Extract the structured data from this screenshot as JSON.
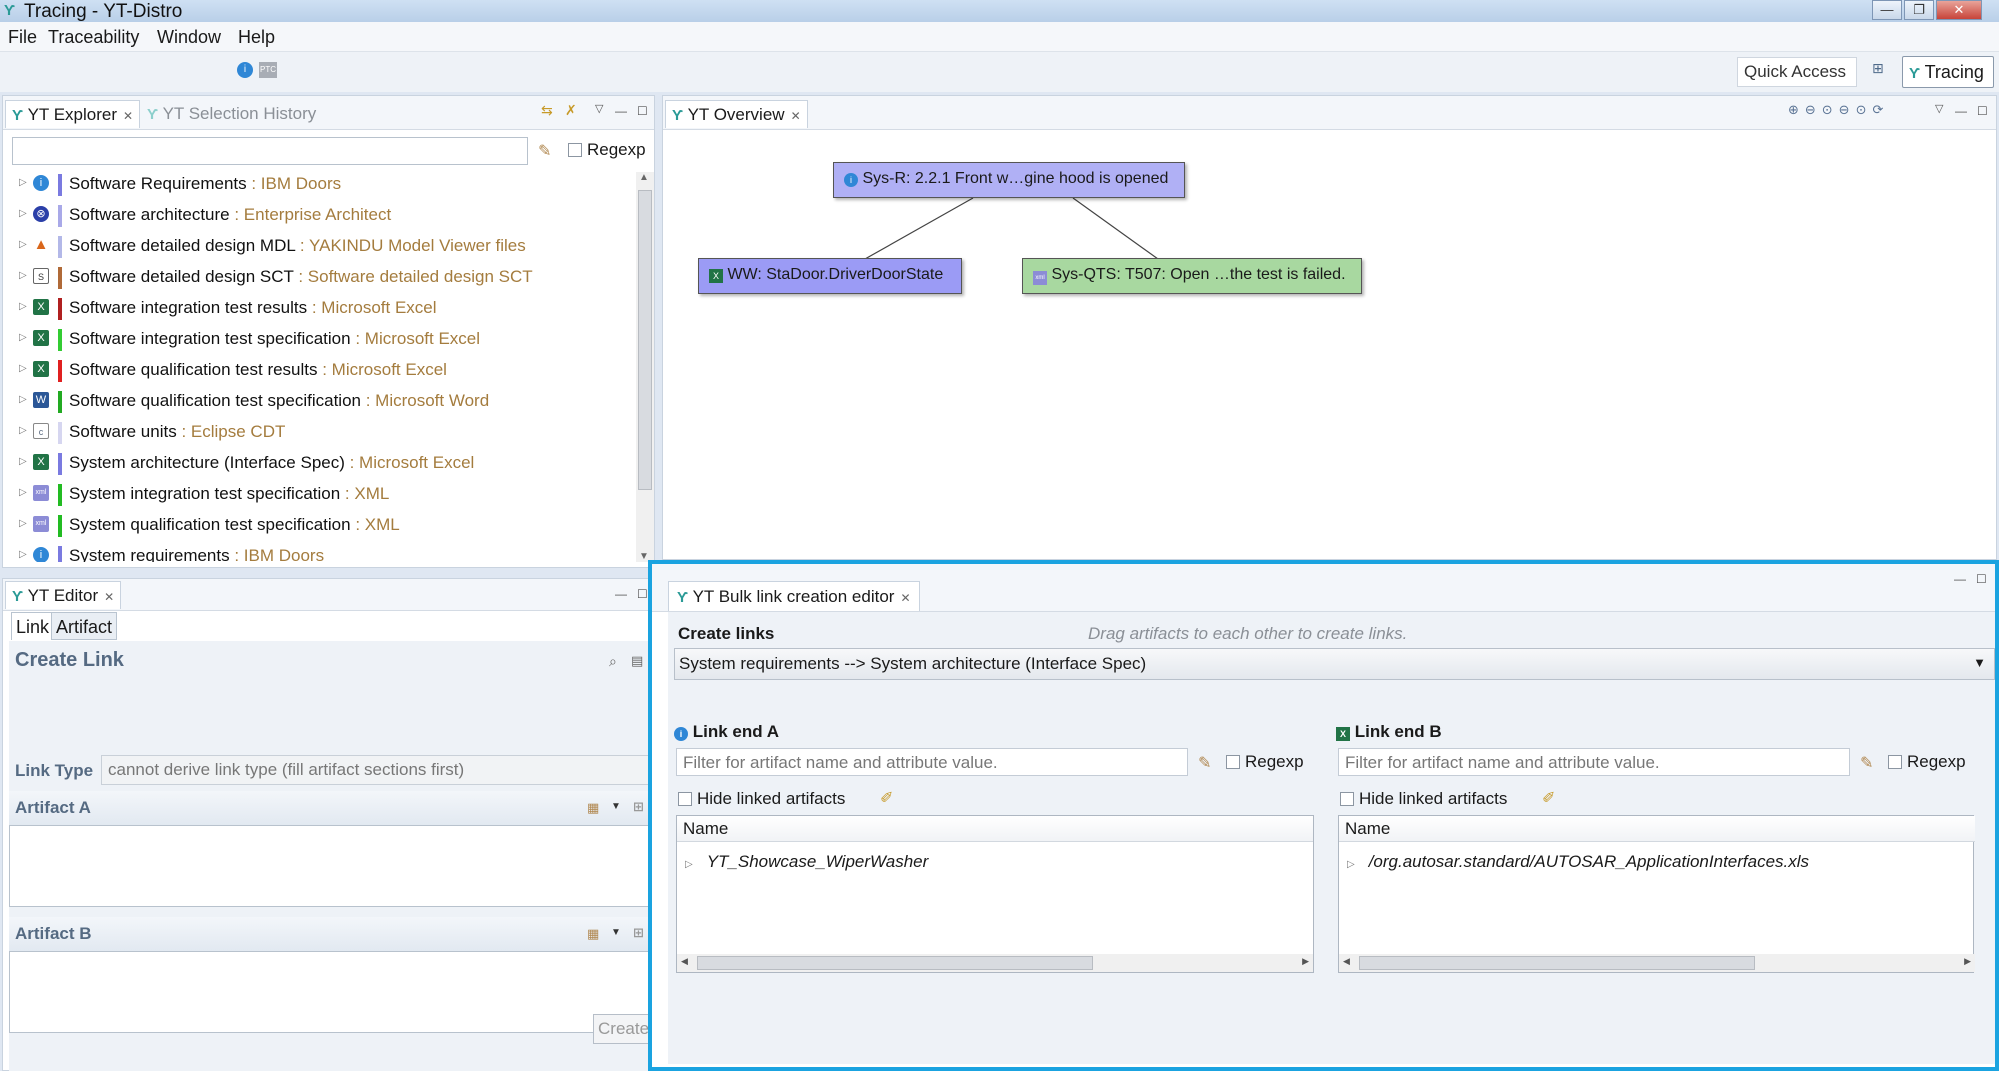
{
  "window": {
    "title": "Tracing - YT-Distro",
    "controls": {
      "minimize": "—",
      "maximize": "❐",
      "close": "✕"
    }
  },
  "menu": [
    "File",
    "Traceability",
    "Window",
    "Help"
  ],
  "toolbar": {
    "quick_access": "Quick Access",
    "perspective": "Tracing"
  },
  "explorer": {
    "tabs": [
      {
        "label": "YT Explorer",
        "active": true
      },
      {
        "label": "YT Selection History",
        "active": false
      }
    ],
    "filter_value": "",
    "regexp_label": "Regexp",
    "items": [
      {
        "name": "Software Requirements",
        "type": " : IBM Doors",
        "icon": "doors-icon",
        "bar": "#7a7ae0"
      },
      {
        "name": "Software architecture",
        "type": " : Enterprise Architect",
        "icon": "ea-icon",
        "bar": "#a9a9e8"
      },
      {
        "name": "Software detailed design MDL",
        "type": " : YAKINDU Model Viewer files",
        "icon": "matlab-icon",
        "bar": "#b3b8e8"
      },
      {
        "name": "Software detailed design SCT",
        "type": " : Software detailed design SCT",
        "icon": "statechart-icon",
        "bar": "#b06a38"
      },
      {
        "name": "Software integration test results",
        "type": " : Microsoft Excel",
        "icon": "excel-icon",
        "bar": "#b02020"
      },
      {
        "name": "Software integration test specification",
        "type": " : Microsoft Excel",
        "icon": "excel-icon",
        "bar": "#33cc33"
      },
      {
        "name": "Software qualification test results",
        "type": " : Microsoft Excel",
        "icon": "excel-icon",
        "bar": "#e02020"
      },
      {
        "name": "Software qualification test specification",
        "type": " : Microsoft Word",
        "icon": "word-icon",
        "bar": "#22aa22"
      },
      {
        "name": "Software units",
        "type": " : Eclipse CDT",
        "icon": "cfile-icon",
        "bar": "#d6d6f0"
      },
      {
        "name": "System architecture (Interface Spec)",
        "type": " : Microsoft Excel",
        "icon": "excel-icon",
        "bar": "#7a7ae0"
      },
      {
        "name": "System integration test specification",
        "type": " : XML",
        "icon": "xml-icon",
        "bar": "#22bb22"
      },
      {
        "name": "System qualification test specification",
        "type": " : XML",
        "icon": "xml-icon",
        "bar": "#22bb22"
      },
      {
        "name": "System requirements",
        "type": " : IBM Doors",
        "icon": "doors-icon",
        "bar": "#7a7ae0"
      }
    ]
  },
  "overview": {
    "tab": "YT Overview",
    "nodes": {
      "sysr": {
        "label": "Sys-R: 2.2.1 Front w…gine hood is opened",
        "color": "#b0b0f5"
      },
      "ww": {
        "label": "WW: StaDoor.DriverDoorState",
        "color": "#9b9bf5"
      },
      "qts": {
        "label": "Sys-QTS: T507: Open …the test is failed.",
        "color": "#a8d8a0"
      }
    }
  },
  "editor": {
    "tab": "YT Editor",
    "subtabs": [
      "Link",
      "Artifact"
    ],
    "title": "Create Link",
    "link_type_label": "Link Type",
    "link_type_value": "cannot derive link type (fill artifact sections first)",
    "artifact_a_label": "Artifact A",
    "artifact_b_label": "Artifact B",
    "create_label": "Create"
  },
  "bulk": {
    "tab": "YT Bulk link creation editor",
    "create_links_label": "Create links",
    "drag_hint": "Drag artifacts to each other to create links.",
    "mapping": "System requirements --> System architecture (Interface Spec)",
    "end_a": {
      "title": "Link end A",
      "filter_placeholder": "Filter for artifact name and attribute value.",
      "regexp_label": "Regexp",
      "hide_linked_label": "Hide linked artifacts",
      "column": "Name",
      "row": "YT_Showcase_WiperWasher"
    },
    "end_b": {
      "title": "Link end B",
      "filter_placeholder": "Filter for artifact name and attribute value.",
      "regexp_label": "Regexp",
      "hide_linked_label": "Hide linked artifacts",
      "column": "Name",
      "row": "/org.autosar.standard/AUTOSAR_ApplicationInterfaces.xls"
    }
  }
}
